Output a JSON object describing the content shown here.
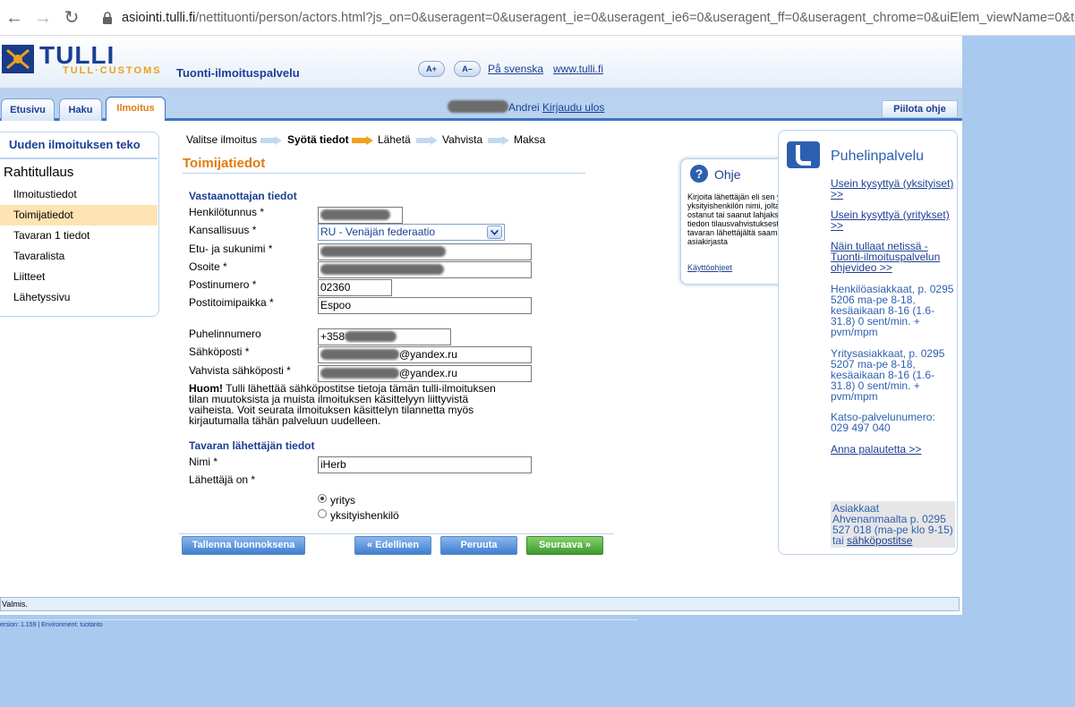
{
  "browser": {
    "url_host": "asiointi.tulli.fi",
    "url_rest": "/nettituonti/person/actors.html?js_on=0&useragent=0&useragent_ie=0&useragent_ie6=0&useragent_ff=0&useragent_chrome=0&uiElem_viewName=0&toker"
  },
  "header": {
    "logo_main": "TULLI",
    "logo_sub": "TULL·CUSTOMS",
    "service_name": "Tuonti-ilmoituspalvelu",
    "font_larger": "A+",
    "font_smaller": "A–",
    "lang_link": "På svenska",
    "site_link": "www.tulli.fi"
  },
  "tabs": [
    {
      "label": "Etusivu"
    },
    {
      "label": "Haku"
    },
    {
      "label": "Ilmoitus"
    }
  ],
  "user": {
    "name": "Andrei",
    "logout": "Kirjaudu ulos"
  },
  "hide_help": "Piilota ohje",
  "leftnav": {
    "title": "Uuden ilmoituksen teko",
    "section": "Rahtitullaus",
    "items": [
      {
        "label": "Ilmoitustiedot"
      },
      {
        "label": "Toimijatiedot"
      },
      {
        "label": "Tavaran 1 tiedot"
      },
      {
        "label": "Tavaralista"
      },
      {
        "label": "Liitteet"
      },
      {
        "label": "Lähetyssivu"
      }
    ]
  },
  "steps": [
    "Valitse ilmoitus",
    "Syötä tiedot",
    "Lähetä",
    "Vahvista",
    "Maksa"
  ],
  "form": {
    "title": "Toimijatiedot",
    "receiver_title": "Vastaanottajan tiedot",
    "labels": {
      "ssn": "Henkilötunnus *",
      "nationality": "Kansallisuus *",
      "name": "Etu- ja sukunimi *",
      "address": "Osoite *",
      "postcode": "Postinumero *",
      "city": "Postitoimipaikka *",
      "phone": "Puhelinnumero",
      "email": "Sähköposti *",
      "email_confirm": "Vahvista sähköposti *"
    },
    "values": {
      "nationality": "RU - Venäjän federaatio",
      "postcode": "02360",
      "city": "Espoo",
      "phone_prefix": "+358",
      "email_domain": "@yandex.ru",
      "email_confirm_domain": "@yandex.ru"
    },
    "notice_bold": "Huom!",
    "notice_text": " Tulli lähettää sähköpostitse tietoja tämän tulli-ilmoituksen tilan muutoksista ja muista ilmoituksen käsittelyyn liittyvistä vaiheista. Voit seurata ilmoituksen käsittelyn tilannetta myös kirjautumalla tähän palveluun uudelleen.",
    "sender_title": "Tavaran lähettäjän tiedot",
    "sender_name_label": "Nimi *",
    "sender_name_value": "iHerb",
    "sender_type_label": "Lähettäjä on *",
    "sender_type_options": [
      "yritys",
      "yksityishenkilö"
    ]
  },
  "buttons": {
    "save_draft": "Tallenna luonnoksena",
    "previous": "Edellinen",
    "cancel": "Peruuta",
    "next": "Seuraava"
  },
  "help": {
    "title": "Ohje",
    "text": "Kirjoita lähettäjän eli sen yrityksen tai yksityishenkilön nimi, jolta olet tavaran ostanut tai saanut lahjaksi. Löydät tiedon tilausvahvistuksesta tai muusta tavaran lähettäjältä saamastasi asiakirjasta",
    "link": "Käyttöohjeet"
  },
  "rightpanel": {
    "title": "Puhelinpalvelu",
    "faq_private": "Usein kysyttyä (yksityiset) >>",
    "faq_business": "Usein kysyttyä (yritykset) >>",
    "video": "Näin tullaat netissä - Tuonti-ilmoituspalvelun ohjevideo >>",
    "private_customers": "Henkilöasiakkaat, p. 0295 5206 ma-pe 8-18, kesäaikaan 8-16 (1.6-31.8) 0 sent/min. + pvm/mpm",
    "business_customers": "Yritysasiakkaat, p. 0295 5207 ma-pe 8-18, kesäaikaan 8-16 (1.6-31.8) 0 sent/min. + pvm/mpm",
    "katso": "Katso-palvelunumero: 029 497 040",
    "feedback": "Anna palautetta >>",
    "aland_text": "Asiakkaat Ahvenanmaalta p. 0295 527 018 (ma-pe klo 9-15) tai ",
    "aland_link": "sähköpostitse"
  },
  "status": "Valmis.",
  "version": "ersion: 1.159 | Environment: tuotanto"
}
